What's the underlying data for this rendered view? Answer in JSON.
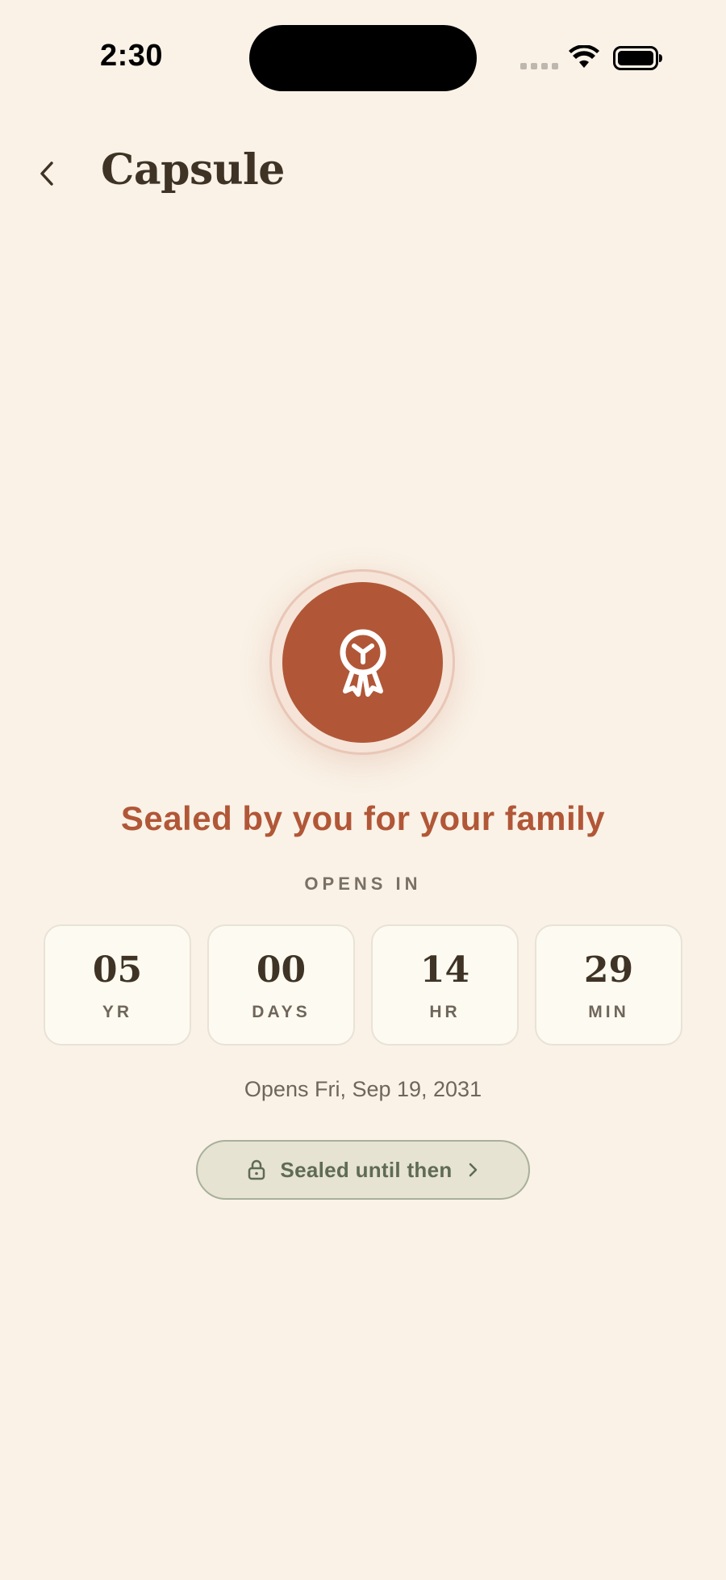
{
  "status_bar": {
    "time": "2:30"
  },
  "header": {
    "title": "Capsule",
    "back_icon": "chevron-left-icon"
  },
  "seal": {
    "icon": "ribbon-seal-icon",
    "caption": "Sealed by you for your family"
  },
  "countdown": {
    "label": "OPENS IN",
    "units": [
      {
        "value": "05",
        "unit": "YR"
      },
      {
        "value": "00",
        "unit": "DAYS"
      },
      {
        "value": "14",
        "unit": "HR"
      },
      {
        "value": "29",
        "unit": "MIN"
      }
    ]
  },
  "opens_date": "Opens Fri, Sep 19, 2031",
  "sealed_button": {
    "label": "Sealed until then",
    "icon": "lock-icon",
    "trailing_icon": "chevron-right-icon"
  },
  "colors": {
    "background": "#faf2e7",
    "accent": "#b15737",
    "text": "#3e3325",
    "pill_bg": "#e6e3d3",
    "pill_text": "#5f6b55"
  }
}
